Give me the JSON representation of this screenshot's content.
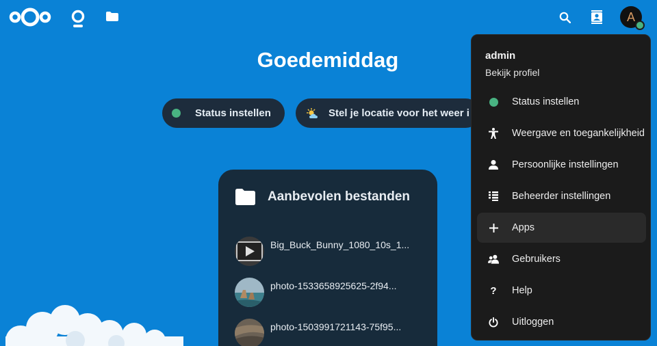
{
  "header": {
    "logo": "nextcloud-logo",
    "nav": [
      {
        "name": "dashboard",
        "icon": "dashboard-icon"
      },
      {
        "name": "files",
        "icon": "folder-icon"
      }
    ],
    "search_icon": "search-icon",
    "contacts_icon": "contacts-icon",
    "avatar_initial": "A",
    "status_color": "#49b382"
  },
  "main": {
    "greeting": "Goedemiddag",
    "status_button": "Status instellen",
    "weather_button": "Stel je locatie voor het weer i"
  },
  "recommended": {
    "title": "Aanbevolen bestanden",
    "files": [
      {
        "name": "Big_Buck_Bunny_1080_10s_1...",
        "thumb": "video-thumbnail"
      },
      {
        "name": "photo-1533658925625-2f94...",
        "thumb": "coast-photo-thumbnail"
      },
      {
        "name": "photo-1503991721143-75f95...",
        "thumb": "canyon-photo-thumbnail"
      }
    ]
  },
  "menu": {
    "username": "admin",
    "profile_link": "Bekijk profiel",
    "items": [
      {
        "label": "Status instellen",
        "icon": "status-dot-icon"
      },
      {
        "label": "Weergave en toegankelijkheid",
        "icon": "accessibility-icon"
      },
      {
        "label": "Persoonlijke instellingen",
        "icon": "person-icon"
      },
      {
        "label": "Beheerder instellingen",
        "icon": "admin-settings-icon"
      },
      {
        "label": "Apps",
        "icon": "plus-icon"
      },
      {
        "label": "Gebruikers",
        "icon": "users-icon"
      },
      {
        "label": "Help",
        "icon": "help-icon"
      },
      {
        "label": "Uitloggen",
        "icon": "power-icon"
      }
    ]
  },
  "colors": {
    "background": "#0a82d6",
    "pill": "#1d2c3c",
    "card": "#172b3b",
    "menu": "#1b1b1b",
    "online": "#49b382"
  }
}
